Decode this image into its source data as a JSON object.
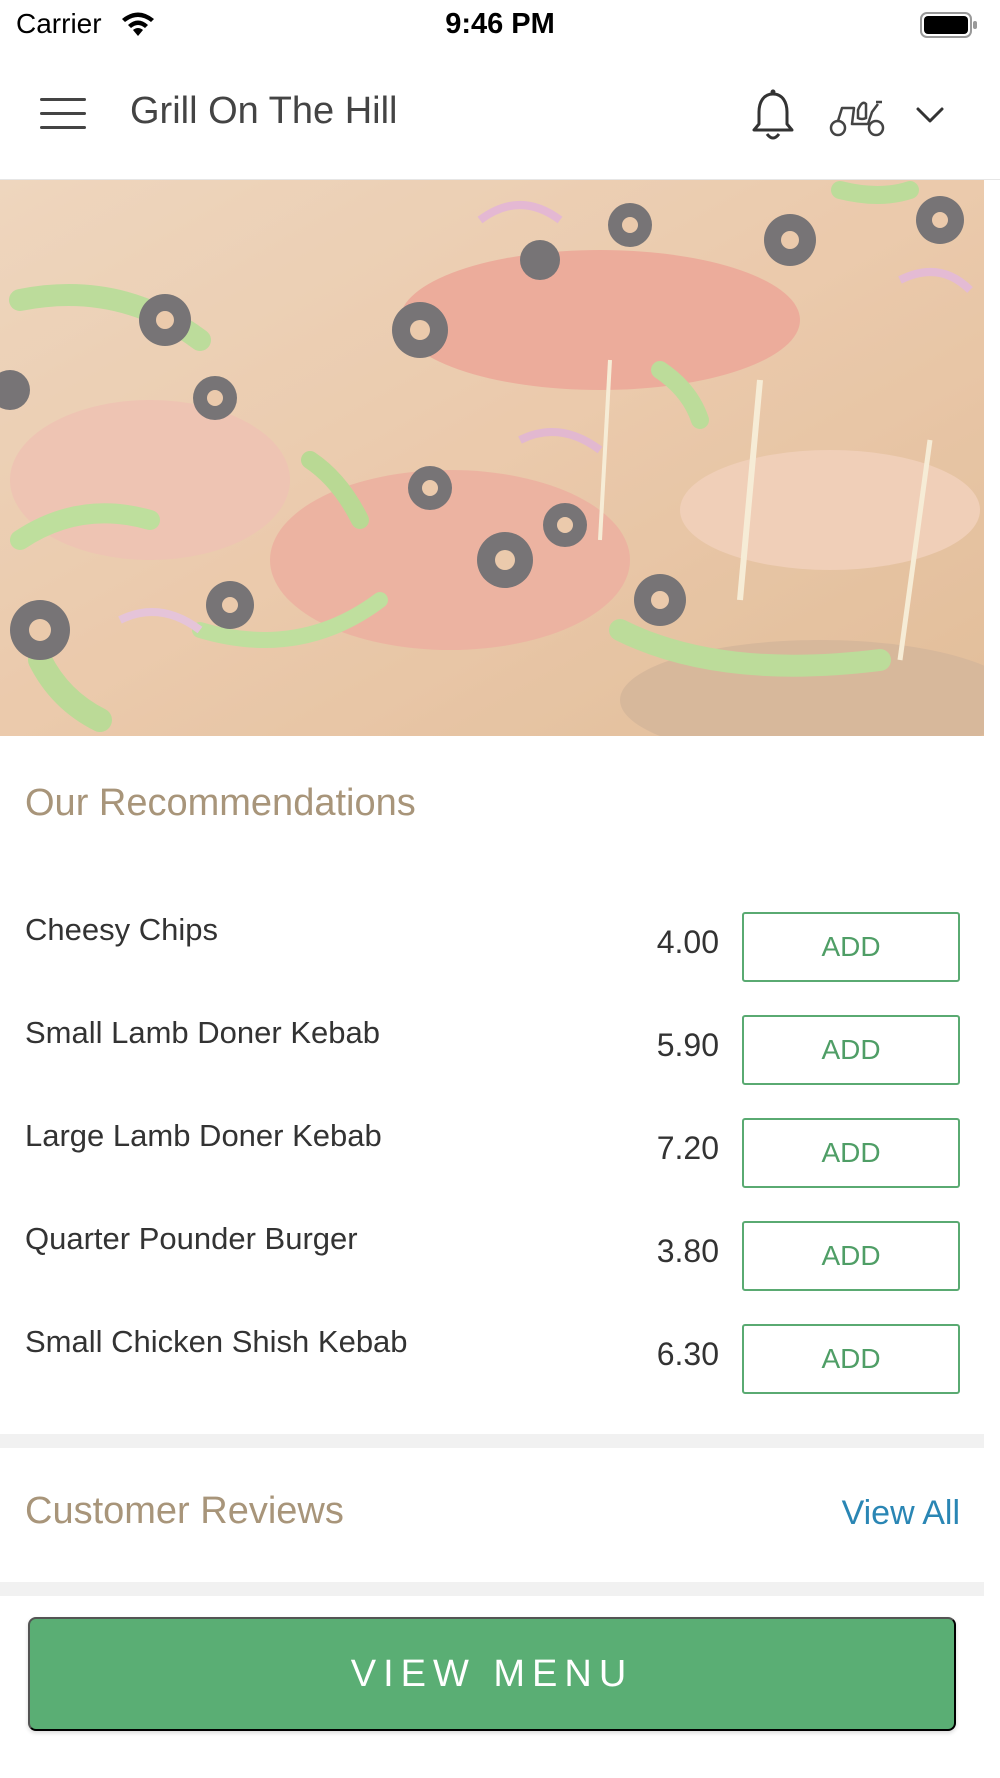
{
  "status_bar": {
    "carrier": "Carrier",
    "time": "9:46 PM"
  },
  "header": {
    "title": "Grill On The Hill",
    "icons": [
      "menu-icon",
      "bell-icon",
      "scooter-icon",
      "chevron-down-icon"
    ]
  },
  "hero": {
    "image": "pizza-photo"
  },
  "recommendations": {
    "title": "Our Recommendations",
    "items": [
      {
        "name": "Cheesy Chips",
        "price": "4.00",
        "action": "ADD"
      },
      {
        "name": "Small Lamb Doner Kebab",
        "price": "5.90",
        "action": "ADD"
      },
      {
        "name": "Large Lamb Doner Kebab",
        "price": "7.20",
        "action": "ADD"
      },
      {
        "name": "Quarter Pounder Burger",
        "price": "3.80",
        "action": "ADD"
      },
      {
        "name": "Small Chicken Shish Kebab",
        "price": "6.30",
        "action": "ADD"
      }
    ]
  },
  "reviews": {
    "title": "Customer Reviews",
    "view_all": "View All"
  },
  "footer": {
    "view_menu": "VIEW MENU"
  },
  "colors": {
    "accent_green": "#5aae74",
    "section_title": "#a8957a",
    "link_blue": "#2a86b4"
  }
}
